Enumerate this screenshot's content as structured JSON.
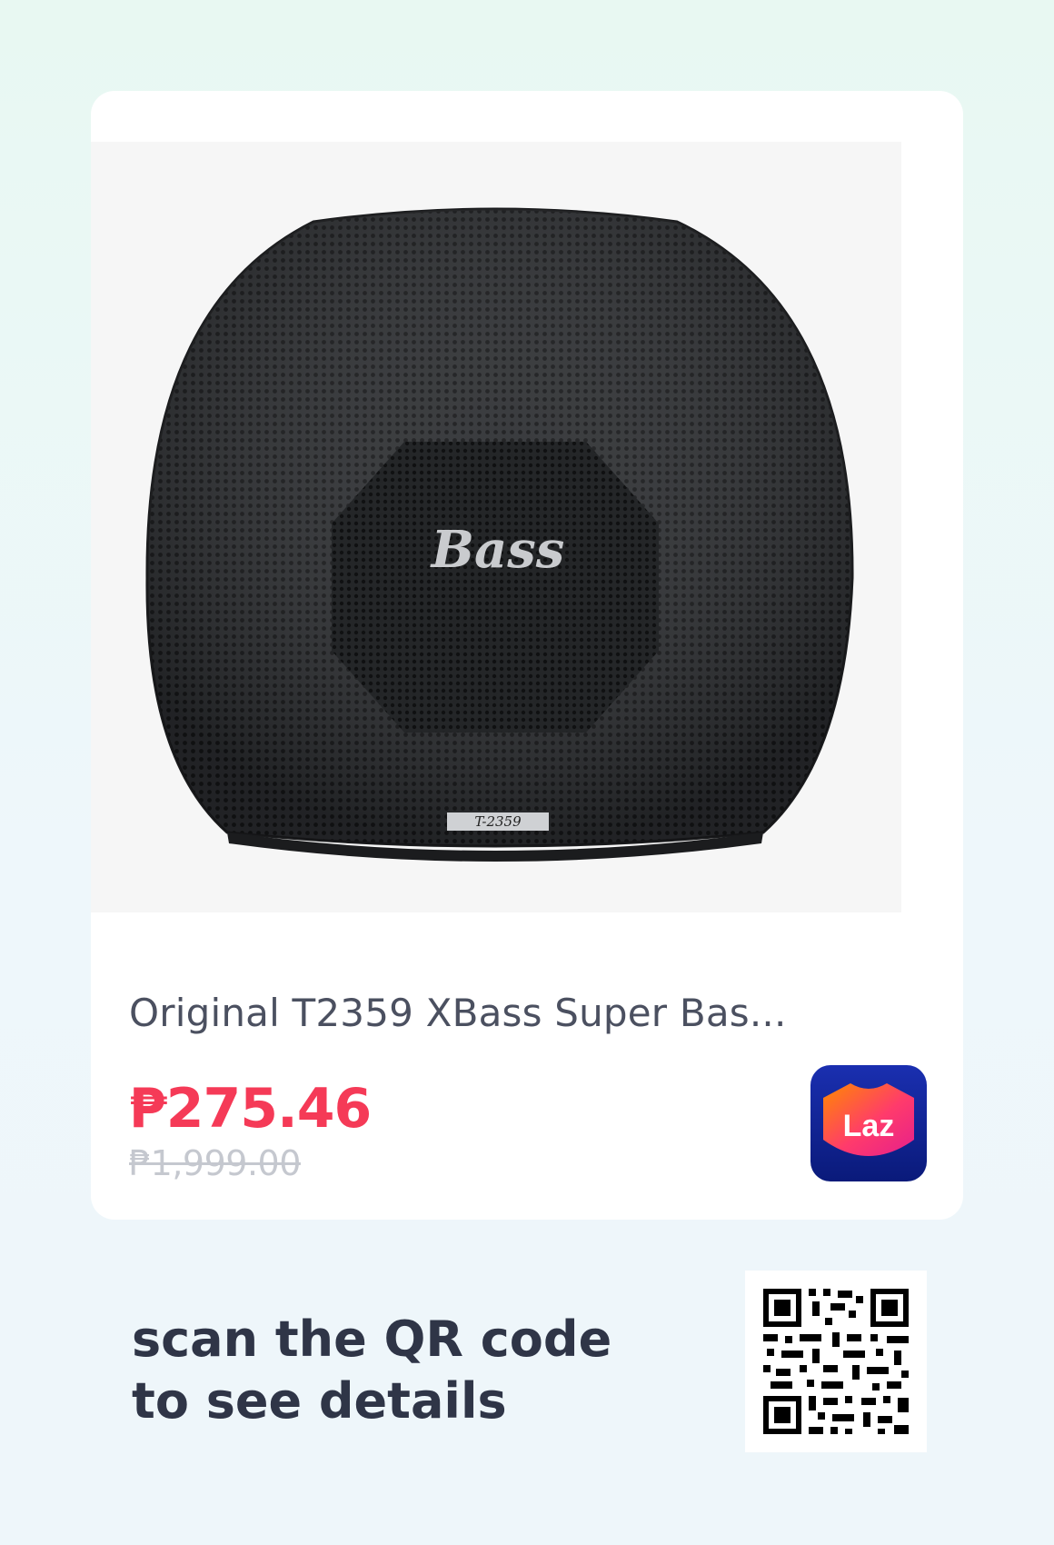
{
  "product": {
    "image_label": "Bass",
    "image_model_label": "T-2359",
    "title": "Original T2359 XBass Super Bas...",
    "price": "₱275.46",
    "original_price": "₱1,999.00"
  },
  "store": {
    "logo_text": "Laz",
    "icon": "lazada-logo-icon"
  },
  "cta": {
    "line1": "scan the QR code",
    "line2": "to see details"
  },
  "qr": {
    "icon": "qr-code-icon"
  },
  "colors": {
    "price": "#f53a57",
    "original_price": "#c5c8cf",
    "title": "#4b5060",
    "cta": "#2f3547",
    "store_bg": "#0a1a7a"
  }
}
